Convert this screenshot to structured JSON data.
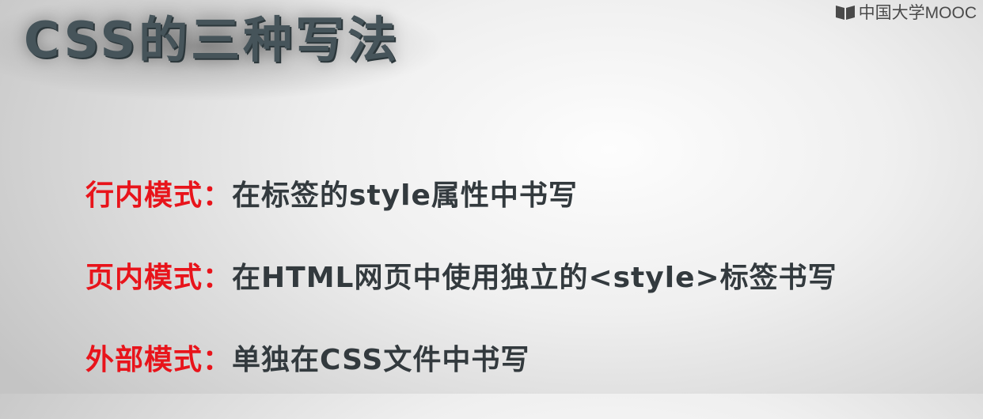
{
  "title": "CSS的三种写法",
  "watermark": {
    "text": "中国大学MOOC",
    "icon": "mooc-book-icon"
  },
  "items": [
    {
      "label": "行内模式：",
      "text": "在标签的style属性中书写"
    },
    {
      "label": "页内模式：",
      "text": "在HTML网页中使用独立的<style>标签书写"
    },
    {
      "label": "外部模式：",
      "text": "单独在CSS文件中书写"
    }
  ],
  "colors": {
    "label": "#e8141b",
    "text": "#333a3e",
    "title": "#46545a"
  }
}
